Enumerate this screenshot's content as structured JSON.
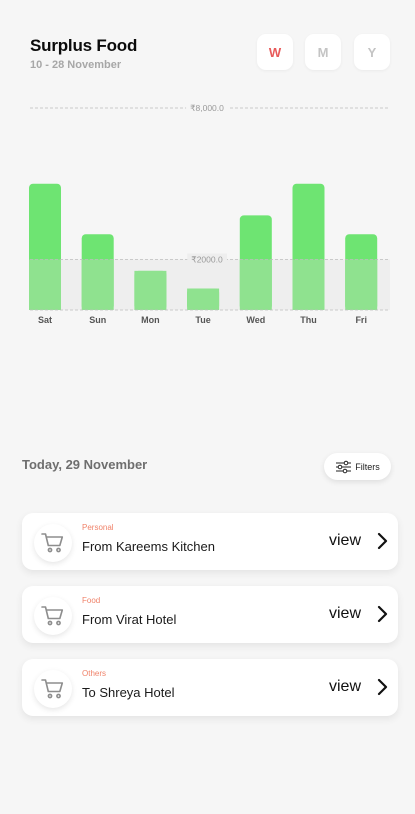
{
  "header": {
    "title": "Surplus Food",
    "subtitle": "10 - 28 November"
  },
  "range_tabs": [
    {
      "label": "W",
      "active": true
    },
    {
      "label": "M",
      "active": false
    },
    {
      "label": "Y",
      "active": false
    }
  ],
  "colors": {
    "bar_top": "#6ee472",
    "bar_bottom": "#8fe28f",
    "band": "#eeeeee",
    "active_tab": "#e85a5a",
    "category": "#f0836a"
  },
  "chart_data": {
    "type": "bar",
    "categories": [
      "Sat",
      "Sun",
      "Mon",
      "Tue",
      "Wed",
      "Thu",
      "Fri"
    ],
    "values": [
      5000,
      3000,
      1550,
      850,
      3750,
      5000,
      3000
    ],
    "reference_lines": [
      {
        "value": 8000,
        "label": "₹8,000.0"
      },
      {
        "value": 2000,
        "label": "₹2000.0"
      }
    ],
    "ylim": [
      0,
      8000
    ]
  },
  "activity": {
    "date_label": "Today, 29 November",
    "filters_label": "Filters",
    "items": [
      {
        "category": "Personal",
        "name": "From Kareems Kitchen",
        "action": "view",
        "icon": "cart-icon"
      },
      {
        "category": "Food",
        "name": "From Virat Hotel",
        "action": "view",
        "icon": "cart-icon"
      },
      {
        "category": "Others",
        "name": "To Shreya Hotel",
        "action": "view",
        "icon": "cart-icon"
      }
    ]
  }
}
